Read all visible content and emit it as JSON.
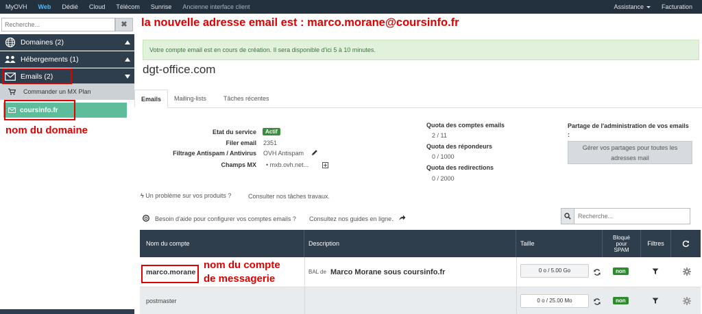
{
  "topbar": {
    "items": [
      "MyOVH",
      "Web",
      "Dédié",
      "Cloud",
      "Télécom",
      "Sunrise",
      "Ancienne interface client"
    ],
    "right": [
      "Assistance",
      "Facturation"
    ]
  },
  "sidebar": {
    "search_placeholder": "Recherche...",
    "clear_label": "✖",
    "items": [
      {
        "label": "Domaines (2)"
      },
      {
        "label": "Hébergements (1)"
      },
      {
        "label": "Emails (2)"
      }
    ],
    "sub_item": "Commander un MX Plan",
    "domain": "coursinfo.fr"
  },
  "annotations": {
    "top": "la nouvelle adresse email est : marco.morane@coursinfo.fr",
    "domain": "nom du domaine",
    "account_line1": "nom du compte",
    "account_line2": "de messagerie"
  },
  "main": {
    "alert": "Votre compte email est en cours de création. Il sera disponible d'ici 5 à 10 minutes.",
    "title": "dgt-office.com",
    "tabs": [
      "Emails",
      "Mailing-lists",
      "Tâches récentes"
    ],
    "info": {
      "state_label": "Etat du service",
      "state_value": "Actif",
      "filer_label": "Filer email",
      "filer_value": "2351",
      "antispam_label": "Filtrage Antispam / Antivirus",
      "antispam_value": "OVH Antispam",
      "mx_label": "Champs MX",
      "mx_value": "mxb.ovh.net..."
    },
    "quotas": {
      "accounts_label": "Quota des comptes emails",
      "accounts_value": "2 / 11",
      "responders_label": "Quota des répondeurs",
      "responders_value": "0 / 1000",
      "redirects_label": "Quota des redirections",
      "redirects_value": "0 / 2000"
    },
    "share": {
      "label": "Partage de l'administration de vos emails",
      "colon": ":",
      "button_line1": "Gérer vos partages pour toutes les",
      "button_line2": "adresses mail"
    },
    "problem_text": "Un problème sur vos produits ?",
    "problem_link": "Consulter nos tâches travaux.",
    "help_text": "Besoin d'aide pour configurer vos comptes emails ?",
    "help_link": "Consultez nos guides en ligne.",
    "table_search_placeholder": "Recherche...",
    "table": {
      "headers": {
        "account": "Nom du compte",
        "description": "Description",
        "size": "Taille",
        "spam1": "Bloqué",
        "spam2": "pour",
        "spam3": "SPAM",
        "filters": "Filtres"
      },
      "rows": [
        {
          "account": "marco.morane",
          "desc_prefix": "BAL de",
          "desc": "Marco Morane sous coursinfo.fr",
          "size": "0 o / 5.00 Go",
          "spam": "non"
        },
        {
          "account": "postmaster",
          "desc_prefix": "",
          "desc": "",
          "size": "0 o / 25.00 Mo",
          "spam": "non"
        }
      ]
    }
  }
}
